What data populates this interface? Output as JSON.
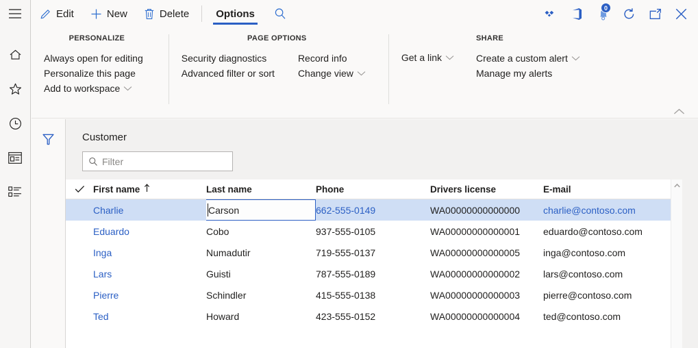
{
  "nav_rail": {
    "menu_label": "Show navigation",
    "items": [
      {
        "name": "home",
        "label": "Home"
      },
      {
        "name": "favorites",
        "label": "Favorites"
      },
      {
        "name": "recent",
        "label": "Recent"
      },
      {
        "name": "workspaces",
        "label": "Workspaces"
      },
      {
        "name": "modules",
        "label": "Modules"
      }
    ]
  },
  "command_bar": {
    "edit_label": "Edit",
    "new_label": "New",
    "delete_label": "Delete",
    "options_tab_label": "Options",
    "search_label": "Search",
    "right_icons": [
      {
        "name": "dynamics-diamond-icon",
        "label": "Dynamics 365"
      },
      {
        "name": "office-icon",
        "label": "Office 365 apps"
      },
      {
        "name": "notifications-icon",
        "label": "Notifications",
        "badge": "0"
      },
      {
        "name": "refresh-icon",
        "label": "Refresh"
      },
      {
        "name": "popout-icon",
        "label": "Open in new window"
      },
      {
        "name": "close-icon",
        "label": "Close"
      }
    ]
  },
  "ribbon": {
    "groups": [
      {
        "title": "PERSONALIZE",
        "columns": [
          [
            {
              "label": "Always open for editing",
              "chevron": false
            },
            {
              "label": "Personalize this page",
              "chevron": false
            },
            {
              "label": "Add to workspace",
              "chevron": true
            }
          ]
        ]
      },
      {
        "title": "PAGE OPTIONS",
        "columns": [
          [
            {
              "label": "Security diagnostics",
              "chevron": false
            },
            {
              "label": "Advanced filter or sort",
              "chevron": false
            }
          ],
          [
            {
              "label": "Record info",
              "chevron": false
            },
            {
              "label": "Change view",
              "chevron": true
            }
          ]
        ]
      },
      {
        "title": "SHARE",
        "columns": [
          [
            {
              "label": "Get a link",
              "chevron": true
            }
          ],
          [
            {
              "label": "Create a custom alert",
              "chevron": true
            },
            {
              "label": "Manage my alerts",
              "chevron": false
            }
          ]
        ]
      }
    ],
    "collapse_label": "Collapse the ribbon"
  },
  "page": {
    "filter_pane_label": "Show filter pane",
    "title": "Customer",
    "filter_placeholder": "Filter"
  },
  "grid": {
    "select_all_label": "Select all",
    "columns": [
      {
        "key": "first",
        "label": "First name",
        "sort": "asc"
      },
      {
        "key": "last",
        "label": "Last name",
        "sort": ""
      },
      {
        "key": "phone",
        "label": "Phone",
        "sort": ""
      },
      {
        "key": "dl",
        "label": "Drivers license",
        "sort": ""
      },
      {
        "key": "email",
        "label": "E-mail",
        "sort": ""
      }
    ],
    "editing_cell": {
      "row": 0,
      "column": "last",
      "value": "Carson",
      "caret_position": "start"
    },
    "rows": [
      {
        "first": "Charlie",
        "last": "Carson",
        "phone": "662-555-0149",
        "dl": "WA00000000000000",
        "email": "charlie@contoso.com",
        "selected": true
      },
      {
        "first": "Eduardo",
        "last": "Cobo",
        "phone": "937-555-0105",
        "dl": "WA00000000000001",
        "email": "eduardo@contoso.com",
        "selected": false
      },
      {
        "first": "Inga",
        "last": "Numadutir",
        "phone": "719-555-0137",
        "dl": "WA00000000000005",
        "email": "inga@contoso.com",
        "selected": false
      },
      {
        "first": "Lars",
        "last": "Guisti",
        "phone": "787-555-0189",
        "dl": "WA00000000000002",
        "email": "lars@contoso.com",
        "selected": false
      },
      {
        "first": "Pierre",
        "last": "Schindler",
        "phone": "415-555-0138",
        "dl": "WA00000000000003",
        "email": "pierre@contoso.com",
        "selected": false
      },
      {
        "first": "Ted",
        "last": "Howard",
        "phone": "423-555-0152",
        "dl": "WA00000000000004",
        "email": "ted@contoso.com",
        "selected": false
      }
    ],
    "scroll_up_label": "Scroll up"
  },
  "colors": {
    "accent": "#2b5fc4",
    "link": "#2b5fc4",
    "selection": "#cfdef5",
    "chrome": "#faf9f8",
    "canvas": "#f2f1f0"
  }
}
